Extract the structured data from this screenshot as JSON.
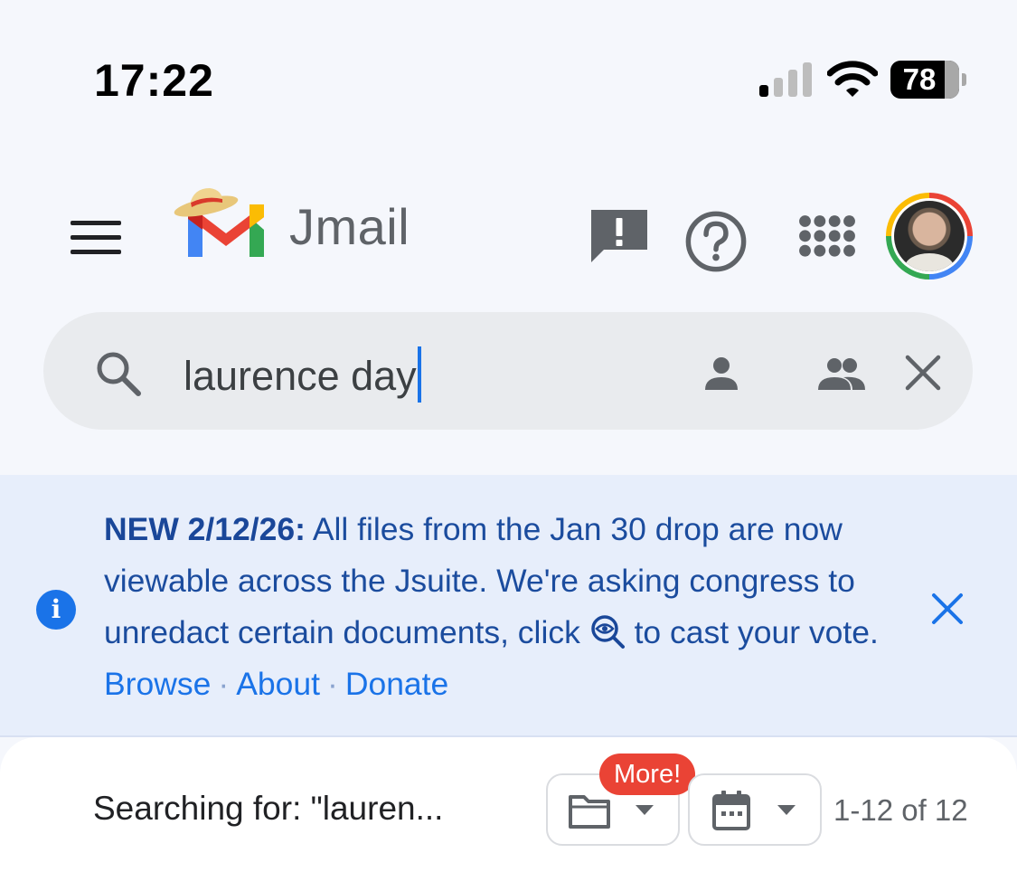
{
  "status_bar": {
    "time": "17:22",
    "battery": "78",
    "icons": [
      "cellular-signal-icon",
      "wifi-icon",
      "battery-icon"
    ]
  },
  "header": {
    "app_name": "Jmail",
    "icons": [
      "menu-icon",
      "jmail-logo",
      "feedback-icon",
      "help-icon",
      "apps-grid-icon",
      "avatar"
    ]
  },
  "search": {
    "query": "laurence day",
    "icons": [
      "search-icon",
      "person-filter-icon",
      "group-filter-icon",
      "clear-icon"
    ]
  },
  "banner": {
    "headline": "NEW 2/12/26:",
    "message_1": " All files from the Jan 30 drop are now viewable across the Jsuite. We're asking congress to unredact certain documents, click ",
    "message_2": " to cast your vote. ",
    "link_browse": "Browse",
    "link_about": "About",
    "link_donate": "Donate",
    "separator": "·"
  },
  "results": {
    "label": "Searching for: \"lauren...",
    "more_badge": "More!",
    "count": "1-12 of 12",
    "filter_icons": [
      "folder-icon",
      "calendar-icon",
      "dropdown-arrow-icon"
    ]
  },
  "colors": {
    "accent_blue": "#1a73e8",
    "banner_bg": "#e7eefb",
    "badge_red": "#ea4335",
    "text_dark": "#202124",
    "text_grey": "#5f6368"
  }
}
